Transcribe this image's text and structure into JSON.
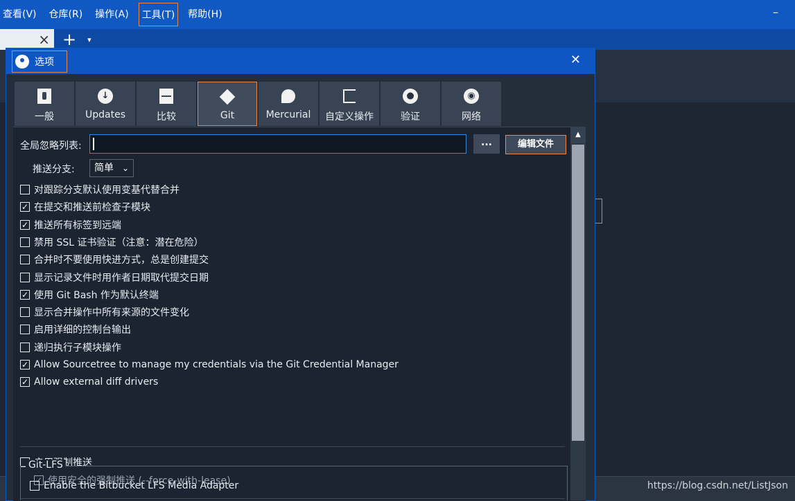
{
  "menu": {
    "items": [
      "查看(V)",
      "仓库(R)",
      "操作(A)",
      "工具(T)",
      "帮助(H)"
    ],
    "minimize": "–"
  },
  "tabbar": {
    "close": "×",
    "add": "+",
    "dropdown": "▾"
  },
  "dialog": {
    "title": "选项",
    "close": "✕",
    "tabs": [
      {
        "label": "一般",
        "icon": "general-icon"
      },
      {
        "label": "Updates",
        "icon": "download-icon"
      },
      {
        "label": "比较",
        "icon": "diff-icon"
      },
      {
        "label": "Git",
        "icon": "git-icon"
      },
      {
        "label": "Mercurial",
        "icon": "mercurial-icon"
      },
      {
        "label": "自定义操作",
        "icon": "custom-actions-icon"
      },
      {
        "label": "验证",
        "icon": "user-icon"
      },
      {
        "label": "网络",
        "icon": "globe-icon"
      }
    ],
    "active_tab": "Git",
    "global_ignore_label": "全局忽略列表:",
    "global_ignore_value": "",
    "browse_label": "...",
    "edit_file_label": "编辑文件",
    "push_branch_label": "推送分支:",
    "push_branch_value": "简单",
    "checkboxes": [
      {
        "label": "对跟踪分支默认使用变基代替合并",
        "checked": false
      },
      {
        "label": "在提交和推送前检查子模块",
        "checked": true
      },
      {
        "label": "推送所有标签到远端",
        "checked": true
      },
      {
        "label": "禁用 SSL 证书验证（注意：潜在危险）",
        "checked": false
      },
      {
        "label": "合并时不要使用快进方式，总是创建提交",
        "checked": false
      },
      {
        "label": "显示记录文件时用作者日期取代提交日期",
        "checked": false
      },
      {
        "label": "使用 Git Bash 作为默认终端",
        "checked": true
      },
      {
        "label": "显示合并操作中所有来源的文件变化",
        "checked": false
      },
      {
        "label": "启用详细的控制台输出",
        "checked": false
      },
      {
        "label": "递归执行子模块操作",
        "checked": false
      },
      {
        "label": "Allow Sourcetree to manage my credentials via the Git Credential Manager",
        "checked": true
      },
      {
        "label": "Allow external diff drivers",
        "checked": true
      }
    ],
    "force_push_label": "启用强制推送",
    "force_push_checked": false,
    "safe_force_push_label": "使用安全的强制推送 (--force-with-lease)",
    "safe_force_push_checked": true,
    "lfs_group_label": "Git-LFS",
    "lfs_adapter_label": "Enable the Bitbucket LFS Media Adapter",
    "lfs_adapter_checked": false
  },
  "watermark": "https://blog.csdn.net/ListJson",
  "check_glyph": "✓"
}
